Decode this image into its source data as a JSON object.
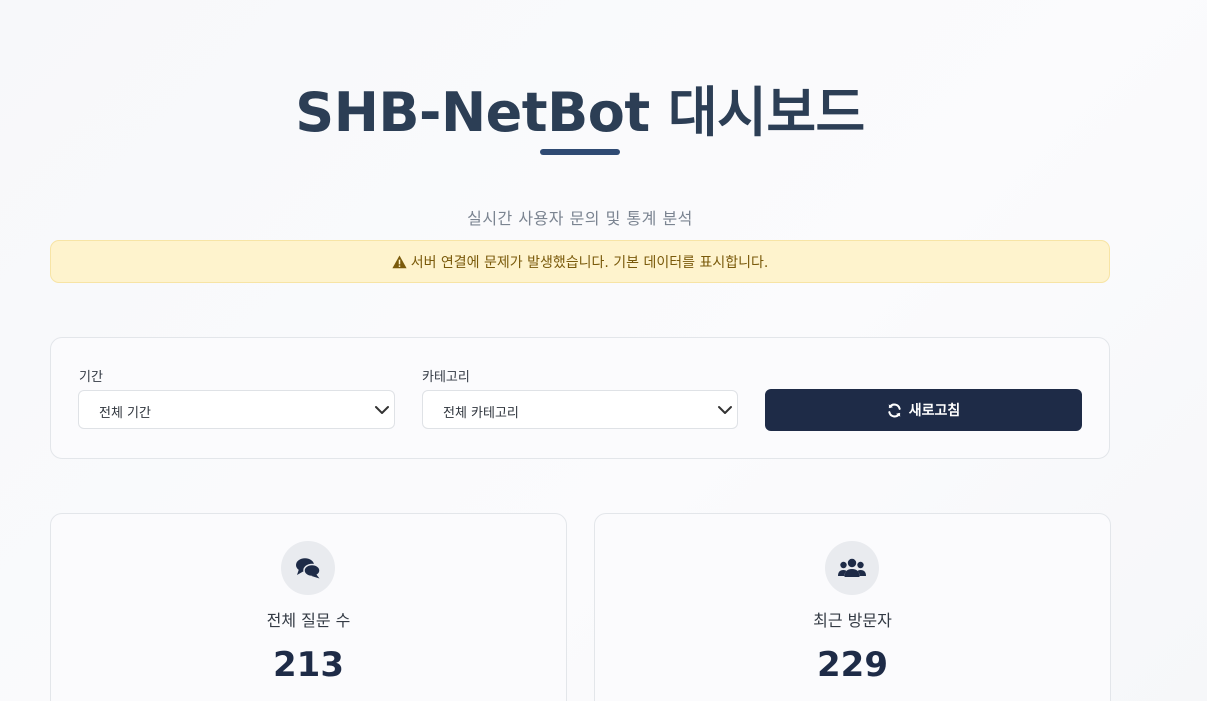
{
  "header": {
    "title": "SHB-NetBot 대시보드",
    "subtitle": "실시간 사용자 문의 및 통계 분석"
  },
  "alert": {
    "icon": "warning-triangle-icon",
    "message": "서버 연결에 문제가 발생했습니다. 기본 데이터를 표시합니다."
  },
  "filters": {
    "period": {
      "label": "기간",
      "selected": "전체 기간"
    },
    "category": {
      "label": "카테고리",
      "selected": "전체 카테고리"
    },
    "refresh_button": {
      "icon": "sync-icon",
      "label": "새로고침"
    }
  },
  "stats": [
    {
      "icon": "comments-icon",
      "label": "전체 질문 수",
      "value": "213"
    },
    {
      "icon": "users-icon",
      "label": "최근 방문자",
      "value": "229"
    }
  ],
  "colors": {
    "title": "#2c3e55",
    "accent": "#1e2b47",
    "alert_bg": "#fef3cd",
    "alert_text": "#7a5a0b"
  }
}
